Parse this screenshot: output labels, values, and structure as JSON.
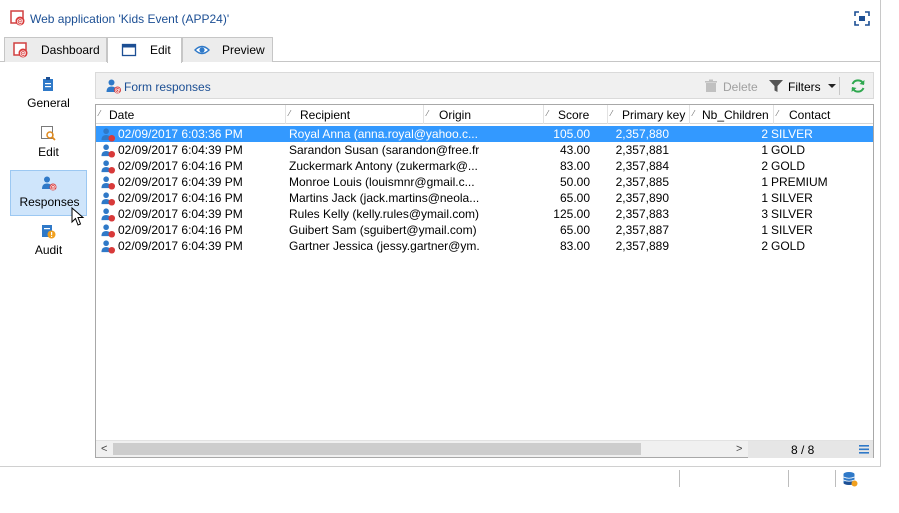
{
  "window": {
    "title": "Web application 'Kids Event (APP24)'",
    "accent_color": "#1c4f94",
    "selection_color": "#3399ff",
    "icons": {
      "app": "web-app-icon",
      "fullscreen": "fullscreen-icon"
    }
  },
  "tabs": [
    {
      "label": "Dashboard",
      "icon": "dashboard-icon",
      "active": false
    },
    {
      "label": "Edit",
      "icon": "edit-window-icon",
      "active": true
    },
    {
      "label": "Preview",
      "icon": "eye-icon",
      "active": false
    }
  ],
  "sidebar": {
    "items": [
      {
        "label": "General",
        "icon": "clipboard-icon",
        "selected": false
      },
      {
        "label": "Edit",
        "icon": "edit-search-icon",
        "selected": false
      },
      {
        "label": "Responses",
        "icon": "user-at-icon",
        "selected": true
      },
      {
        "label": "Audit",
        "icon": "audit-icon",
        "selected": false
      }
    ]
  },
  "toolbar": {
    "title": "Form responses",
    "delete_label": "Delete",
    "filters_label": "Filters",
    "icons": {
      "title": "user-at-icon",
      "delete": "trash-icon",
      "filters": "funnel-icon",
      "refresh": "refresh-icon"
    }
  },
  "grid": {
    "columns": [
      "Date",
      "Recipient",
      "Origin",
      "Score",
      "Primary key",
      "Nb_Children",
      "Contact"
    ],
    "rows": [
      {
        "date": "02/09/2017 6:03:36 PM",
        "recipient": "Royal Anna (anna.royal@yahoo.c...",
        "origin": "",
        "score": "105.00",
        "primary_key": "2,357,880",
        "nb_children": "2",
        "contact": "SILVER",
        "selected": true
      },
      {
        "date": "02/09/2017 6:04:39 PM",
        "recipient": "Sarandon Susan (sarandon@free.fr)",
        "origin": "",
        "score": "43.00",
        "primary_key": "2,357,881",
        "nb_children": "1",
        "contact": "GOLD",
        "selected": false
      },
      {
        "date": "02/09/2017 6:04:16 PM",
        "recipient": "Zuckermark Antony (zukermark@...",
        "origin": "",
        "score": "83.00",
        "primary_key": "2,357,884",
        "nb_children": "2",
        "contact": "GOLD",
        "selected": false
      },
      {
        "date": "02/09/2017 6:04:39 PM",
        "recipient": "Monroe Louis (louismnr@gmail.c...",
        "origin": "",
        "score": "50.00",
        "primary_key": "2,357,885",
        "nb_children": "1",
        "contact": "PREMIUM",
        "selected": false
      },
      {
        "date": "02/09/2017 6:04:16 PM",
        "recipient": "Martins Jack (jack.martins@neola...",
        "origin": "",
        "score": "65.00",
        "primary_key": "2,357,890",
        "nb_children": "1",
        "contact": "SILVER",
        "selected": false
      },
      {
        "date": "02/09/2017 6:04:39 PM",
        "recipient": "Rules Kelly (kelly.rules@ymail.com)",
        "origin": "",
        "score": "125.00",
        "primary_key": "2,357,883",
        "nb_children": "3",
        "contact": "SILVER",
        "selected": false
      },
      {
        "date": "02/09/2017 6:04:16 PM",
        "recipient": "Guibert Sam (sguibert@ymail.com)",
        "origin": "",
        "score": "65.00",
        "primary_key": "2,357,887",
        "nb_children": "1",
        "contact": "SILVER",
        "selected": false
      },
      {
        "date": "02/09/2017 6:04:39 PM",
        "recipient": "Gartner Jessica (jessy.gartner@ym...",
        "origin": "",
        "score": "83.00",
        "primary_key": "2,357,889",
        "nb_children": "2",
        "contact": "GOLD",
        "selected": false
      }
    ],
    "row_icon": "user-at-icon",
    "count_text": "8 / 8",
    "scroll_left": "<",
    "scroll_right": ">",
    "menu_icon": "list-menu-icon"
  },
  "statusbar": {
    "icon": "database-icon"
  }
}
